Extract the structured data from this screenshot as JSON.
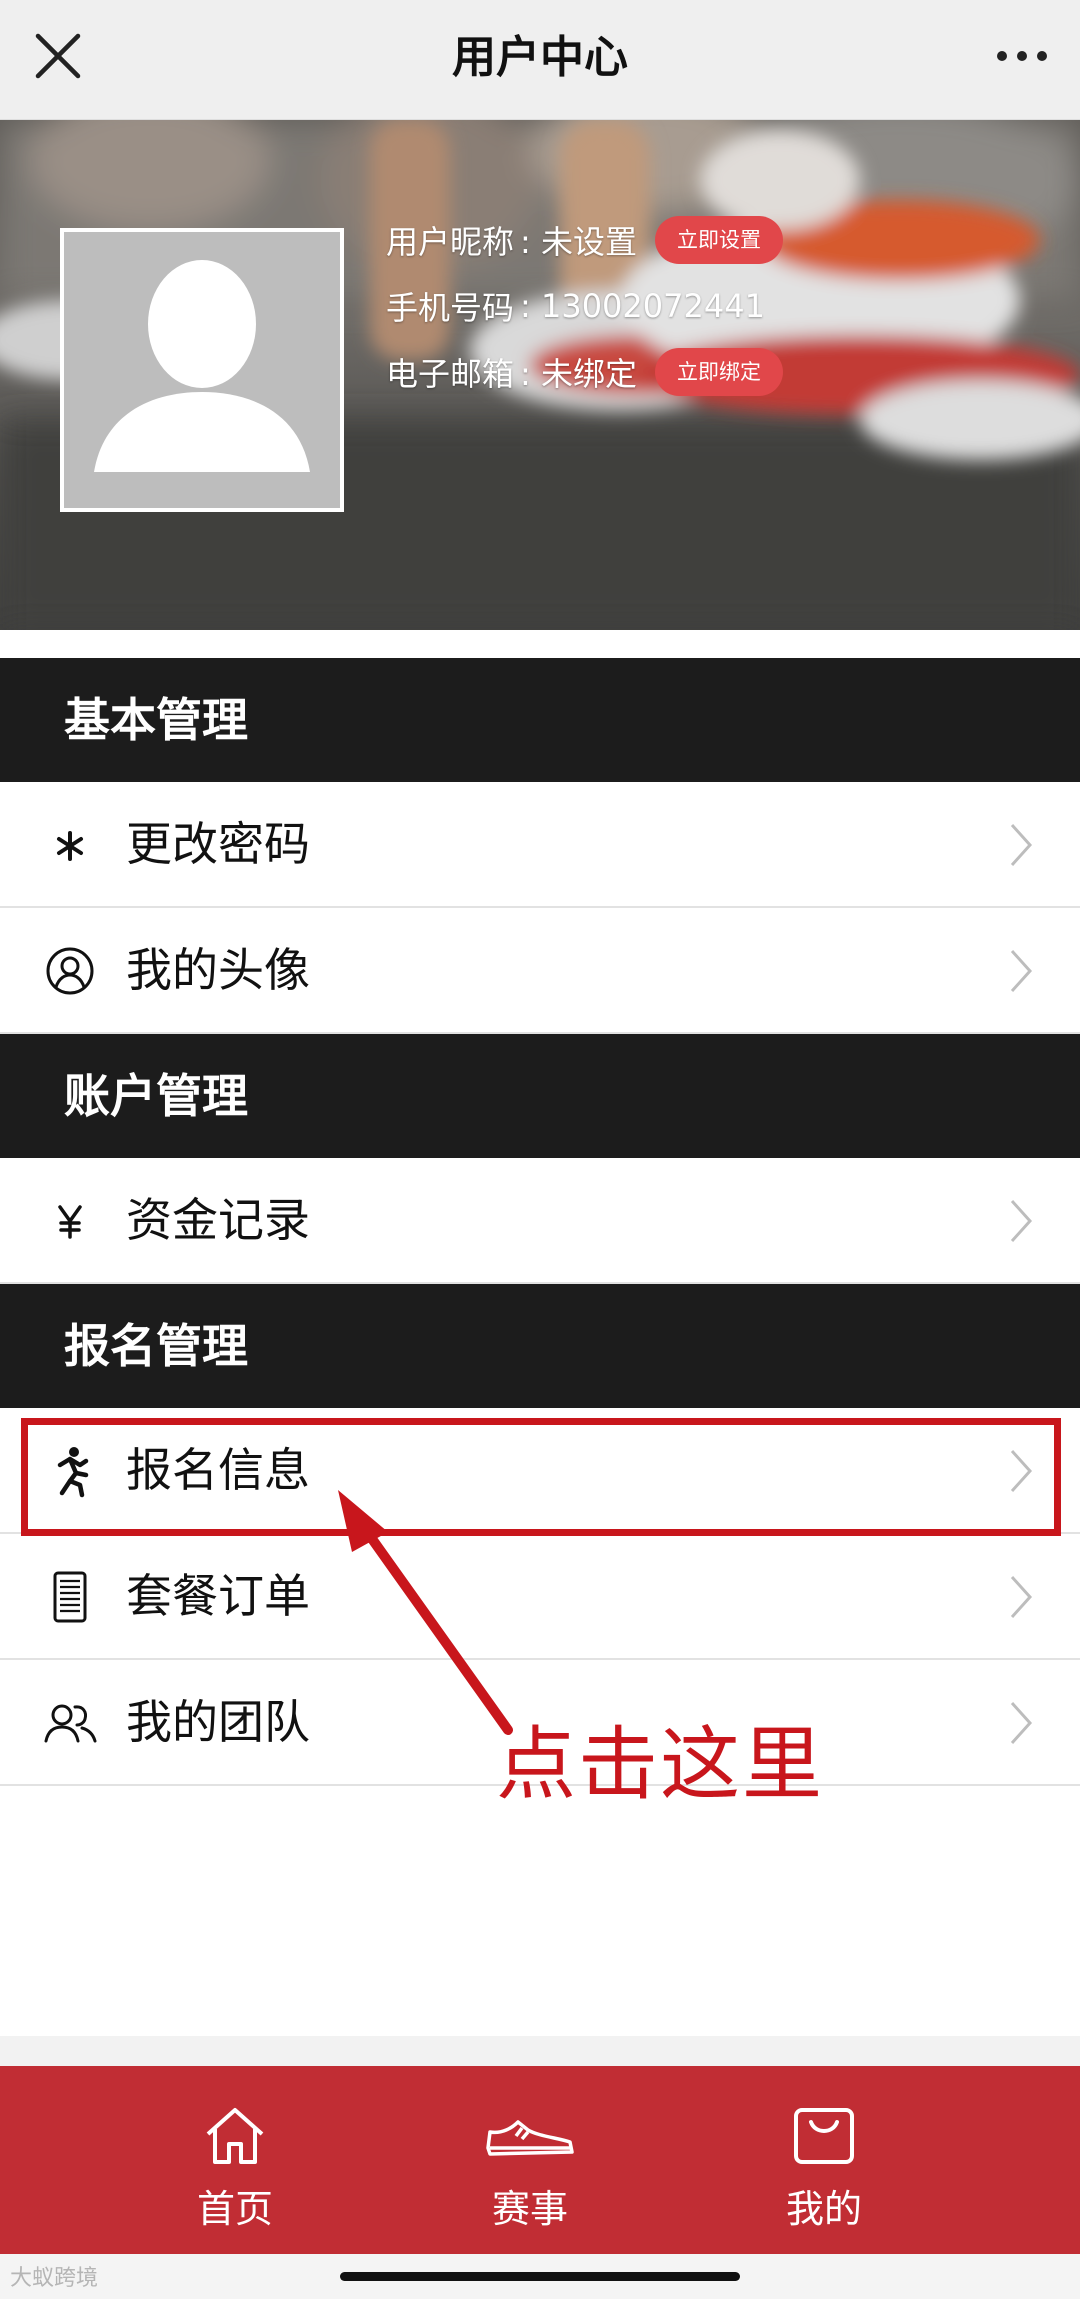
{
  "navbar": {
    "title": "用户中心",
    "close_icon": "close-icon",
    "more_icon": "more-dots-icon"
  },
  "profile": {
    "nickname_label": "用户昵称",
    "nickname_value": ": 未设置",
    "nickname_action": "立即设置",
    "phone_label": "手机号码",
    "phone_value": ": 13002072441",
    "email_label": "电子邮箱",
    "email_value": ": 未绑定",
    "email_action": "立即绑定",
    "avatar_icon": "default-avatar-silhouette"
  },
  "sections": [
    {
      "title": "基本管理",
      "items": [
        {
          "label": "更改密码",
          "icon": "asterisk-icon"
        },
        {
          "label": "我的头像",
          "icon": "user-circle-icon"
        }
      ]
    },
    {
      "title": "账户管理",
      "items": [
        {
          "label": "资金记录",
          "icon": "yen-icon"
        }
      ]
    },
    {
      "title": "报名管理",
      "items": [
        {
          "label": "报名信息",
          "icon": "runner-icon"
        },
        {
          "label": "套餐订单",
          "icon": "order-list-icon"
        },
        {
          "label": "我的团队",
          "icon": "team-icon"
        }
      ]
    }
  ],
  "annotation": {
    "text": "点击这里",
    "color": "#c8161c"
  },
  "tabbar": {
    "tabs": [
      {
        "label": "首页",
        "icon": "home-icon"
      },
      {
        "label": "赛事",
        "icon": "sneaker-icon"
      },
      {
        "label": "我的",
        "icon": "bag-icon"
      }
    ],
    "background": "#c12d34"
  },
  "watermark": "大蚁跨境"
}
